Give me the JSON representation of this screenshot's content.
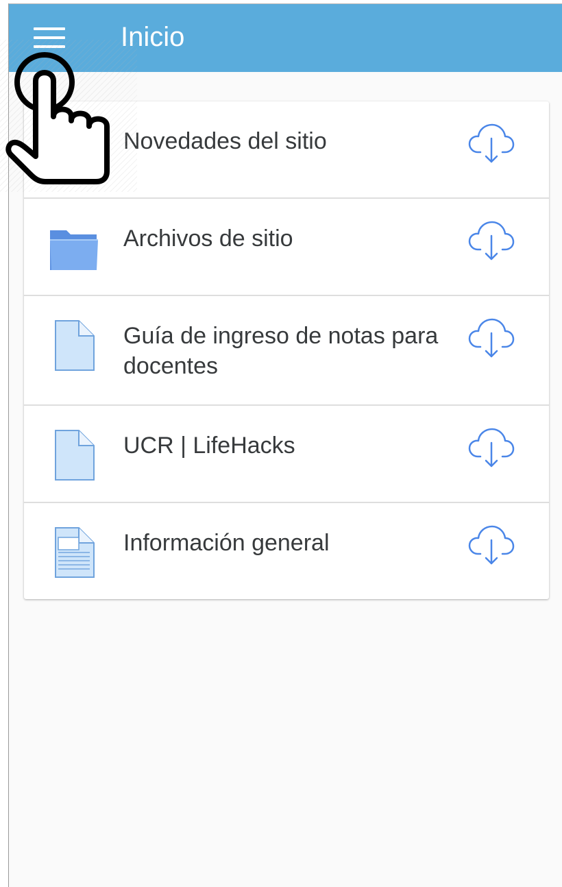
{
  "header": {
    "title": "Inicio",
    "background_color": "#5aacdc",
    "menu_icon": "hamburger-menu-icon"
  },
  "list": {
    "items": [
      {
        "label": "Novedades del sitio",
        "icon": "forum-icon",
        "action_icon": "cloud-download-icon"
      },
      {
        "label": "Archivos de sitio",
        "icon": "folder-icon",
        "action_icon": "cloud-download-icon"
      },
      {
        "label": "Guía de ingreso de notas para docentes",
        "icon": "file-icon",
        "action_icon": "cloud-download-icon"
      },
      {
        "label": "UCR | LifeHacks",
        "icon": "file-icon",
        "action_icon": "cloud-download-icon"
      },
      {
        "label": "Información general",
        "icon": "page-icon",
        "action_icon": "cloud-download-icon"
      }
    ]
  },
  "overlay": {
    "icon": "tap-hand-icon"
  },
  "colors": {
    "accent": "#5aacdc",
    "download_icon": "#4a86e8",
    "text": "#373a3c",
    "divider": "#dedede"
  }
}
